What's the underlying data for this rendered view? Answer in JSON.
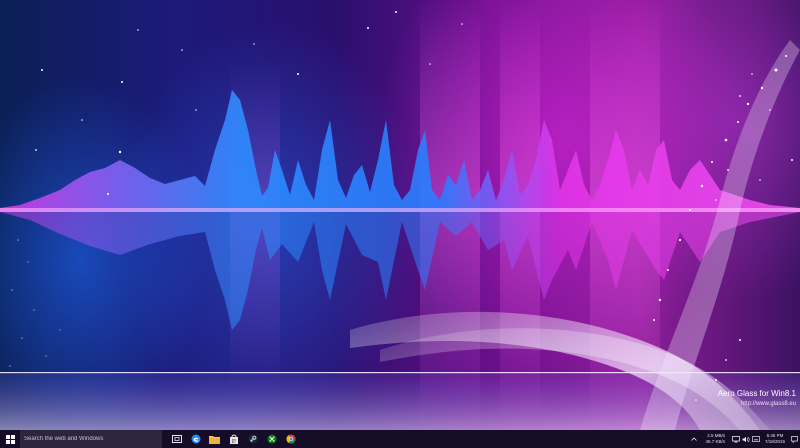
{
  "desktop": {
    "watermark_title": "Aero Glass for Win8.1",
    "watermark_url": "http://www.glass8.eu"
  },
  "taskbar": {
    "search_placeholder": "Search the web and Windows",
    "pinned": [
      "task-view",
      "edge",
      "file-explorer",
      "store",
      "steam",
      "xbox",
      "chrome"
    ],
    "tray": {
      "net_up": "2.5 MB/s",
      "net_down": "45.7 KB/s",
      "time": "5:45 PM",
      "date": "7/18/2015"
    }
  },
  "colors": {
    "accent_blue": "#1e8bff",
    "accent_magenta": "#e030e6",
    "taskbar": "#160e28"
  }
}
